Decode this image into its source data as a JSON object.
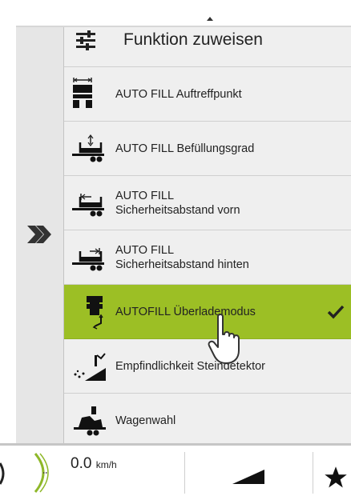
{
  "header": {
    "title": "Funktion zuweisen",
    "icon": "sliders-icon"
  },
  "menu": {
    "items": [
      {
        "line1": "AUTO FILL Auftreffpunkt",
        "line2": "",
        "icon": "truck-impact-point-icon",
        "active": false
      },
      {
        "line1": "AUTO FILL Befüllungsgrad",
        "line2": "",
        "icon": "trailer-fill-level-icon",
        "active": false
      },
      {
        "line1": "AUTO FILL",
        "line2": "Sicherheitsabstand vorn",
        "icon": "trailer-front-distance-icon",
        "active": false
      },
      {
        "line1": "AUTO FILL",
        "line2": "Sicherheitsabstand hinten",
        "icon": "trailer-rear-distance-icon",
        "active": false
      },
      {
        "line1": "AUTOFILL Überlademodus",
        "line2": "",
        "icon": "overload-mode-icon",
        "active": true
      },
      {
        "line1": "Empfindlichkeit Steindetektor",
        "line2": "",
        "icon": "stone-detector-icon",
        "active": false
      },
      {
        "line1": "Wagenwahl",
        "line2": "",
        "icon": "wagon-selection-icon",
        "active": false
      }
    ]
  },
  "status": {
    "speed": "0.0",
    "speed_unit": "km/h"
  },
  "colors": {
    "active": "#9cbf25",
    "menu_bg": "#efefef",
    "gauge": "#8fb82a"
  }
}
